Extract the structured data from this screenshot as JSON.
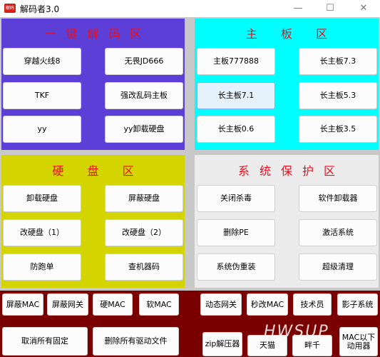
{
  "window": {
    "title": "解码者3.0",
    "icon_text": "解码"
  },
  "panels": {
    "decode": {
      "title": "一键解码区",
      "color": "#5b3fd6",
      "buttons": [
        "穿越火线8",
        "无畏JD666",
        "TKF",
        "强改乱码主板",
        "yy",
        "yy卸载硬盘"
      ]
    },
    "board": {
      "title": "主 板 区",
      "color": "#00ffff",
      "buttons": [
        "主板777888",
        "长主板7.3",
        "长主板7.1",
        "长主板5.3",
        "长主板0.6",
        "长主板3.5"
      ]
    },
    "disk": {
      "title": "硬 盘 区",
      "color": "#d4d400",
      "buttons": [
        "卸载硬盘",
        "屏蔽硬盘",
        "改硬盘（1）",
        "改硬盘（2）",
        "防跑单",
        "查机器码"
      ]
    },
    "protect": {
      "title": "系统保护区",
      "color": "#ececec",
      "buttons": [
        "关闭杀毒",
        "软件卸载器",
        "删除PE",
        "激活系统",
        "系统伪重装",
        "超级清理"
      ]
    }
  },
  "bottom": {
    "color": "#7a0000",
    "row1": [
      "屏蔽MAC",
      "屏蔽网关",
      "硬MAC",
      "软MAC",
      "动态网关",
      "秒改MAC",
      "技术员",
      "影子系统"
    ],
    "row2": [
      "取消所有固定",
      "删除所有驱动文件",
      "zip解压器",
      "天猫",
      "畔千",
      "MAC以下动用器"
    ]
  },
  "watermark": "HWSUP"
}
